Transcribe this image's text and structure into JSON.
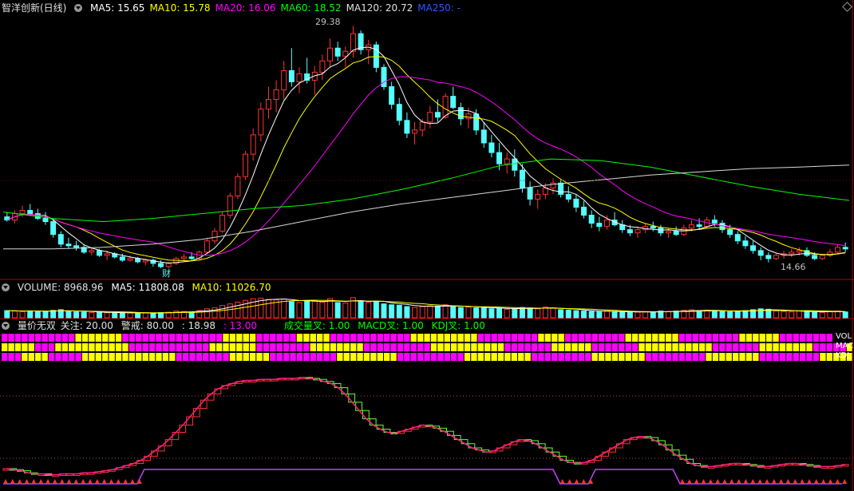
{
  "header": {
    "stock_name": "智洋创新(日线)",
    "ma": [
      {
        "label": "MA5: 15.65",
        "color": "#ffffff"
      },
      {
        "label": "MA10: 15.78",
        "color": "#ffff00"
      },
      {
        "label": "MA20: 16.06",
        "color": "#ff00ff"
      },
      {
        "label": "MA60: 18.52",
        "color": "#00ff00"
      },
      {
        "label": "MA120: 20.72",
        "color": "#e0e0e0"
      },
      {
        "label": "MA250: -",
        "color": "#3355ff"
      }
    ]
  },
  "volume_header": {
    "title": "VOLUME: 8968.96",
    "ma5": "MA5: 11808.08",
    "ma10": "MA10: 11026.70"
  },
  "indicator_header": {
    "name": "量价无双",
    "focus": "关注: 20.00",
    "alert": "警戒: 80.00",
    "v1": ": 18.98",
    "v2": ": 13.00",
    "cross_vol": "成交量叉: 1.00",
    "cross_macd": "MACD叉: 1.00",
    "cross_kdj": "KDJ叉: 1.00"
  },
  "annotations": {
    "high_label": "29.38",
    "low_label": "14.66",
    "cai_label": "财",
    "row_labels": [
      "VOL",
      "MAC",
      "KDJ"
    ]
  },
  "colors": {
    "up": "#ff3232",
    "down": "#54ffff",
    "magenta": "#ff00ff",
    "yellow": "#ffff00",
    "green": "#00ff00",
    "divider": "#b00000"
  },
  "chart_data": {
    "type": "candlestick",
    "price_range": [
      14.0,
      30.0
    ],
    "ohlc": [
      [
        17.5,
        17.8,
        17.2,
        17.3
      ],
      [
        17.3,
        17.9,
        17.1,
        17.7
      ],
      [
        17.7,
        18.2,
        17.5,
        17.9
      ],
      [
        17.9,
        18.3,
        17.6,
        17.7
      ],
      [
        17.7,
        18.0,
        17.3,
        17.4
      ],
      [
        17.4,
        17.8,
        17.0,
        17.2
      ],
      [
        17.2,
        17.4,
        16.2,
        16.4
      ],
      [
        16.4,
        16.6,
        15.6,
        15.8
      ],
      [
        15.8,
        16.2,
        15.5,
        15.7
      ],
      [
        15.7,
        16.0,
        15.4,
        15.6
      ],
      [
        15.6,
        15.8,
        15.2,
        15.3
      ],
      [
        15.3,
        15.6,
        15.1,
        15.4
      ],
      [
        15.4,
        15.5,
        15.0,
        15.1
      ],
      [
        15.1,
        15.4,
        14.8,
        15.2
      ],
      [
        15.2,
        15.3,
        14.9,
        15.0
      ],
      [
        15.0,
        15.2,
        14.7,
        14.8
      ],
      [
        14.8,
        15.1,
        14.7,
        14.9
      ],
      [
        14.9,
        15.0,
        14.6,
        14.7
      ],
      [
        14.7,
        14.9,
        14.5,
        14.8
      ],
      [
        14.8,
        14.9,
        14.4,
        14.6
      ],
      [
        14.6,
        14.8,
        14.3,
        14.4
      ],
      [
        14.4,
        14.7,
        14.3,
        14.6
      ],
      [
        14.6,
        15.0,
        14.5,
        14.9
      ],
      [
        14.9,
        15.2,
        14.7,
        15.0
      ],
      [
        15.0,
        15.3,
        14.8,
        14.9
      ],
      [
        14.9,
        15.4,
        14.8,
        15.3
      ],
      [
        15.3,
        16.2,
        15.2,
        16.0
      ],
      [
        16.0,
        16.8,
        15.8,
        16.6
      ],
      [
        16.6,
        17.8,
        16.5,
        17.6
      ],
      [
        17.6,
        19.0,
        17.4,
        18.8
      ],
      [
        18.8,
        20.2,
        18.6,
        20.0
      ],
      [
        20.0,
        21.6,
        19.8,
        21.4
      ],
      [
        21.4,
        23.0,
        21.0,
        22.6
      ],
      [
        22.6,
        24.6,
        22.2,
        24.2
      ],
      [
        24.2,
        25.6,
        23.6,
        24.8
      ],
      [
        24.8,
        26.0,
        24.0,
        25.4
      ],
      [
        25.4,
        27.2,
        24.8,
        26.6
      ],
      [
        26.6,
        28.0,
        25.6,
        25.9
      ],
      [
        25.9,
        26.8,
        25.2,
        26.4
      ],
      [
        26.4,
        27.4,
        25.8,
        26.0
      ],
      [
        26.0,
        26.9,
        25.1,
        26.5
      ],
      [
        26.5,
        27.6,
        26.0,
        27.2
      ],
      [
        27.2,
        28.6,
        26.8,
        28.0
      ],
      [
        28.0,
        28.4,
        27.2,
        27.5
      ],
      [
        27.5,
        28.1,
        26.8,
        27.8
      ],
      [
        27.8,
        29.38,
        27.4,
        28.9
      ],
      [
        28.9,
        29.1,
        27.6,
        27.9
      ],
      [
        27.9,
        28.5,
        27.0,
        28.2
      ],
      [
        28.2,
        28.4,
        26.5,
        26.8
      ],
      [
        26.8,
        27.0,
        25.4,
        25.6
      ],
      [
        25.6,
        25.9,
        24.2,
        24.5
      ],
      [
        24.5,
        24.9,
        23.2,
        23.5
      ],
      [
        23.5,
        24.0,
        22.4,
        22.7
      ],
      [
        22.7,
        23.4,
        22.0,
        22.9
      ],
      [
        22.9,
        23.6,
        22.5,
        23.4
      ],
      [
        23.4,
        24.4,
        23.0,
        24.0
      ],
      [
        24.0,
        24.8,
        23.4,
        23.7
      ],
      [
        23.7,
        25.2,
        23.6,
        25.0
      ],
      [
        25.0,
        25.6,
        24.2,
        24.3
      ],
      [
        24.3,
        24.6,
        23.2,
        23.6
      ],
      [
        23.6,
        24.3,
        23.0,
        23.9
      ],
      [
        23.9,
        24.2,
        22.6,
        22.9
      ],
      [
        22.9,
        23.4,
        21.8,
        22.1
      ],
      [
        22.1,
        22.6,
        21.2,
        21.5
      ],
      [
        21.5,
        22.1,
        20.4,
        20.8
      ],
      [
        20.8,
        21.5,
        20.2,
        21.1
      ],
      [
        21.1,
        21.7,
        20.0,
        20.4
      ],
      [
        20.4,
        20.8,
        19.0,
        19.3
      ],
      [
        19.3,
        19.7,
        18.2,
        18.6
      ],
      [
        18.6,
        19.2,
        18.0,
        18.9
      ],
      [
        18.9,
        19.6,
        18.6,
        19.3
      ],
      [
        19.3,
        19.9,
        18.9,
        19.6
      ],
      [
        19.6,
        19.8,
        18.7,
        18.9
      ],
      [
        18.9,
        19.4,
        18.4,
        18.6
      ],
      [
        18.6,
        18.9,
        17.8,
        18.1
      ],
      [
        18.1,
        18.5,
        17.4,
        17.6
      ],
      [
        17.6,
        17.9,
        16.8,
        17.1
      ],
      [
        17.1,
        17.5,
        16.6,
        16.9
      ],
      [
        16.9,
        17.6,
        16.7,
        17.3
      ],
      [
        17.3,
        17.8,
        16.9,
        17.0
      ],
      [
        17.0,
        17.3,
        16.5,
        16.7
      ],
      [
        16.7,
        17.0,
        16.3,
        16.5
      ],
      [
        16.5,
        16.9,
        16.2,
        16.7
      ],
      [
        16.7,
        17.1,
        16.5,
        16.9
      ],
      [
        16.9,
        17.2,
        16.6,
        16.8
      ],
      [
        16.8,
        17.0,
        16.3,
        16.5
      ],
      [
        16.5,
        16.8,
        16.2,
        16.6
      ],
      [
        16.6,
        16.9,
        16.3,
        16.4
      ],
      [
        16.4,
        17.0,
        16.3,
        16.8
      ],
      [
        16.8,
        17.3,
        16.6,
        17.0
      ],
      [
        17.0,
        17.4,
        16.7,
        16.9
      ],
      [
        16.9,
        17.5,
        16.8,
        17.3
      ],
      [
        17.3,
        17.6,
        16.9,
        17.1
      ],
      [
        17.1,
        17.3,
        16.5,
        16.7
      ],
      [
        16.7,
        17.0,
        16.2,
        16.4
      ],
      [
        16.4,
        16.6,
        15.8,
        16.0
      ],
      [
        16.0,
        16.3,
        15.5,
        15.7
      ],
      [
        15.7,
        16.0,
        15.2,
        15.4
      ],
      [
        15.4,
        15.6,
        14.8,
        15.1
      ],
      [
        15.1,
        15.3,
        14.66,
        14.9
      ],
      [
        14.9,
        15.2,
        14.8,
        15.1
      ],
      [
        15.1,
        15.4,
        14.9,
        15.2
      ],
      [
        15.2,
        15.5,
        15.0,
        15.3
      ],
      [
        15.3,
        15.6,
        15.1,
        15.4
      ],
      [
        15.4,
        15.6,
        15.0,
        15.1
      ],
      [
        15.1,
        15.3,
        14.8,
        14.9
      ],
      [
        14.9,
        15.2,
        14.8,
        15.1
      ],
      [
        15.1,
        15.5,
        15.0,
        15.3
      ],
      [
        15.3,
        15.8,
        15.2,
        15.6
      ],
      [
        15.6,
        15.9,
        15.3,
        15.5
      ]
    ],
    "ma_series": [
      {
        "label": "MA5",
        "color": "#ffffff",
        "period": 5
      },
      {
        "label": "MA10",
        "color": "#ffff00",
        "period": 10
      },
      {
        "label": "MA20",
        "color": "#ff00ff",
        "period": 20
      }
    ],
    "ma60_values": [
      17.8,
      17.4,
      17.2,
      17.4,
      17.7,
      18.0,
      18.2,
      18.6,
      19.2,
      19.9,
      20.7,
      21.1,
      21.0,
      20.6,
      20.0,
      19.4,
      18.9,
      18.52
    ],
    "ma120_values": [
      15.5,
      15.5,
      15.6,
      15.8,
      16.1,
      16.6,
      17.2,
      17.8,
      18.3,
      18.7,
      19.1,
      19.5,
      19.8,
      20.1,
      20.3,
      20.5,
      20.6,
      20.72
    ],
    "volume": {
      "values": [
        0.32,
        0.3,
        0.28,
        0.31,
        0.3,
        0.27,
        0.33,
        0.36,
        0.3,
        0.26,
        0.25,
        0.24,
        0.23,
        0.22,
        0.24,
        0.22,
        0.21,
        0.2,
        0.22,
        0.21,
        0.23,
        0.25,
        0.3,
        0.28,
        0.26,
        0.33,
        0.4,
        0.45,
        0.55,
        0.62,
        0.7,
        0.78,
        0.85,
        0.88,
        0.82,
        0.8,
        0.84,
        0.72,
        0.68,
        0.76,
        0.74,
        0.7,
        0.86,
        0.68,
        0.66,
        0.9,
        0.74,
        0.7,
        0.72,
        0.62,
        0.58,
        0.56,
        0.5,
        0.46,
        0.5,
        0.54,
        0.52,
        0.58,
        0.5,
        0.46,
        0.48,
        0.44,
        0.46,
        0.4,
        0.42,
        0.38,
        0.4,
        0.46,
        0.44,
        0.4,
        0.48,
        0.44,
        0.36,
        0.34,
        0.32,
        0.3,
        0.28,
        0.26,
        0.3,
        0.28,
        0.26,
        0.24,
        0.25,
        0.27,
        0.26,
        0.3,
        0.28,
        0.3,
        0.34,
        0.36,
        0.32,
        0.34,
        0.3,
        0.28,
        0.26,
        0.3,
        0.32,
        0.36,
        0.4,
        0.38,
        0.3,
        0.28,
        0.26,
        0.3,
        0.28,
        0.26,
        0.24,
        0.28,
        0.3,
        0.26
      ]
    },
    "row_patterns": [
      "MMMMMMMMMMMYYYYYYYMMMMMMMMMMMMMMMYYYYYMMMMMMYYYYYMMMMMMMMMMMMYYYYYYYYYYMMMMMMMMMYYYYMMMMMMMMMYYYYYYYYMMMMMMMMMYYYYYYMMMMMMMM",
      "YYYYYMMMYYYYYYYYYYYMMMMMMMMMMMMYYYYYYYMMMMMMMMYYYYYYYYMMMMMMMMMMYYYYYYYYYYYMMMMMMMYYYYYYMMMMMMMYYYYYYYYYYYMMMMMMMYYYYYYYYMMMMMY",
      "MMMYYYYMMMMMYYYYYYYYYYYYYYMMMMMMMMYYYYYYMMMMMMMMMMYYYYYYYYYMMMMMMMMMMYYYYYYYYYYMMMMMMMMMYYYYYYYYMMMMMMMMMYYYYYYYYMMMMMMMMMYYYYY"
    ],
    "oscillator": [
      10,
      9,
      8,
      6,
      5,
      5,
      4,
      4,
      5,
      5,
      5,
      6,
      6,
      7,
      8,
      9,
      11,
      13,
      15,
      18,
      22,
      27,
      32,
      38,
      45,
      52,
      60,
      68,
      76,
      82,
      87,
      90,
      92,
      94,
      95,
      95,
      96,
      96,
      96,
      97,
      97,
      97,
      98,
      97,
      96,
      94,
      92,
      88,
      82,
      74,
      66,
      58,
      52,
      48,
      45,
      44,
      46,
      48,
      50,
      52,
      51,
      49,
      46,
      42,
      38,
      34,
      30,
      28,
      26,
      27,
      30,
      33,
      36,
      38,
      37,
      34,
      30,
      26,
      22,
      18,
      16,
      15,
      16,
      18,
      22,
      26,
      30,
      34,
      38,
      40,
      41,
      40,
      37,
      33,
      28,
      23,
      19,
      15,
      13,
      12,
      12,
      13,
      14,
      15,
      15,
      14,
      13,
      12,
      12,
      13,
      14,
      15,
      15,
      14,
      13,
      12,
      12,
      12,
      13,
      14
    ]
  }
}
